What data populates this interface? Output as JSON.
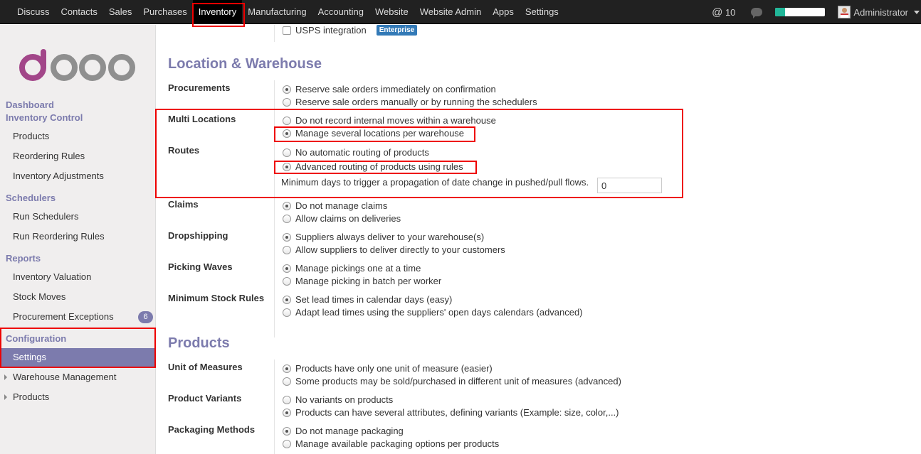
{
  "topbar": {
    "menu": [
      "Discuss",
      "Contacts",
      "Sales",
      "Purchases",
      "Inventory",
      "Manufacturing",
      "Accounting",
      "Website",
      "Website Admin",
      "Apps",
      "Settings"
    ],
    "active": "Inventory",
    "mentions_count": "10",
    "progress_fraction": 0.2,
    "user": "Administrator"
  },
  "sidebar": {
    "logo": "odoo",
    "dashboard": "Dashboard",
    "inventory_control": "Inventory Control",
    "products": "Products",
    "reordering_rules": "Reordering Rules",
    "inventory_adjustments": "Inventory Adjustments",
    "schedulers": "Schedulers",
    "run_schedulers": "Run Schedulers",
    "run_reordering_rules": "Run Reordering Rules",
    "reports": "Reports",
    "inventory_valuation": "Inventory Valuation",
    "stock_moves": "Stock Moves",
    "procurement_exceptions": "Procurement Exceptions",
    "procurement_exceptions_count": "6",
    "configuration": "Configuration",
    "settings": "Settings",
    "warehouse_management": "Warehouse Management",
    "products_group": "Products"
  },
  "main": {
    "usps": {
      "label": "USPS integration",
      "badge": "Enterprise",
      "checked": false
    },
    "location_section": "Location & Warehouse",
    "procurements": {
      "label": "Procurements",
      "opt1": "Reserve sale orders immediately on confirmation",
      "opt2": "Reserve sale orders manually or by running the schedulers",
      "selected": 1
    },
    "multi_locations": {
      "label": "Multi Locations",
      "opt1": "Do not record internal moves within a warehouse",
      "opt2": "Manage several locations per warehouse",
      "selected": 2
    },
    "routes": {
      "label": "Routes",
      "opt1": "No automatic routing of products",
      "opt2": "Advanced routing of products using rules",
      "selected": 2,
      "min_days_label": "Minimum days to trigger a propagation of date change in pushed/pull flows.",
      "min_days_value": "0"
    },
    "claims": {
      "label": "Claims",
      "opt1": "Do not manage claims",
      "opt2": "Allow claims on deliveries",
      "selected": 1
    },
    "dropshipping": {
      "label": "Dropshipping",
      "opt1": "Suppliers always deliver to your warehouse(s)",
      "opt2": "Allow suppliers to deliver directly to your customers",
      "selected": 1
    },
    "picking_waves": {
      "label": "Picking Waves",
      "opt1": "Manage pickings one at a time",
      "opt2": "Manage picking in batch per worker",
      "selected": 1
    },
    "min_stock_rules": {
      "label": "Minimum Stock Rules",
      "opt1": "Set lead times in calendar days (easy)",
      "opt2": "Adapt lead times using the suppliers' open days calendars (advanced)",
      "selected": 1
    },
    "products_section": "Products",
    "unit_of_measures": {
      "label": "Unit of Measures",
      "opt1": "Products have only one unit of measure (easier)",
      "opt2": "Some products may be sold/purchased in different unit of measures (advanced)",
      "selected": 1
    },
    "product_variants": {
      "label": "Product Variants",
      "opt1": "No variants on products",
      "opt2": "Products can have several attributes, defining variants (Example: size, color,...)",
      "selected": 2
    },
    "packaging_methods": {
      "label": "Packaging Methods",
      "opt1": "Do not manage packaging",
      "opt2": "Manage available packaging options per products",
      "selected": 1
    }
  },
  "colors": {
    "accent": "#7c7bad",
    "topbar": "#212121",
    "highlight": "#e00000",
    "enterprise": "#337ab7"
  }
}
